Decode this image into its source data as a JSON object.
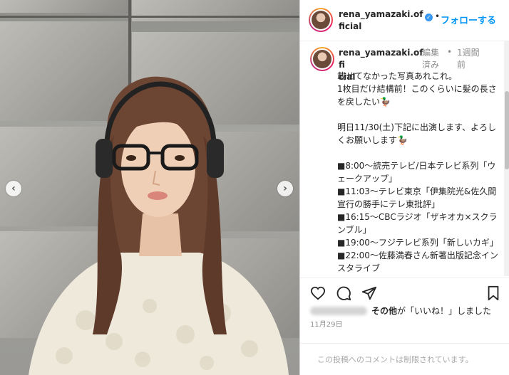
{
  "post": {
    "username_line1": "rena_yamazaki.of",
    "username_line2": "ficial",
    "follow_label": "フォローする",
    "separator": "•"
  },
  "caption": {
    "username_line1": "rena_yamazaki.offi",
    "username_line2": "cial",
    "edited": "編集済み",
    "separator": "•",
    "time": "1週間前",
    "text": "載せてなかった写真あれこれ。\n1枚目だけ結構前！このくらいに髪の長さを戻したい🦆\n\n明日11/30(土)下記に出演します、よろしくお願いします🦆\n\n■8:00～読売テレビ/日本テレビ系列「ウェークアップ」\n■11:03～テレビ東京「伊集院光&佐久間宣行の勝手にテレ東批評」\n■16:15～CBCラジオ「ザキオカ×スクランブル」\n■19:00～フジテレビ系列「新しいカギ」\n■22:00～佐藤満春さん新著出版記念インスタライブ"
  },
  "likes": {
    "others_label": "その他",
    "suffix": "が「いいね！」しました"
  },
  "date": "11月29日",
  "comments_disabled": "この投稿へのコメントは制限されています。",
  "icons": {
    "heart": "heart-icon",
    "comment": "comment-icon",
    "share": "share-icon",
    "bookmark": "bookmark-icon",
    "verified": "verified-badge-icon",
    "prev": "chevron-left-icon",
    "next": "chevron-right-icon"
  },
  "colors": {
    "accent": "#0095f6",
    "verified": "#3897f0",
    "muted": "#8e8e8e"
  }
}
